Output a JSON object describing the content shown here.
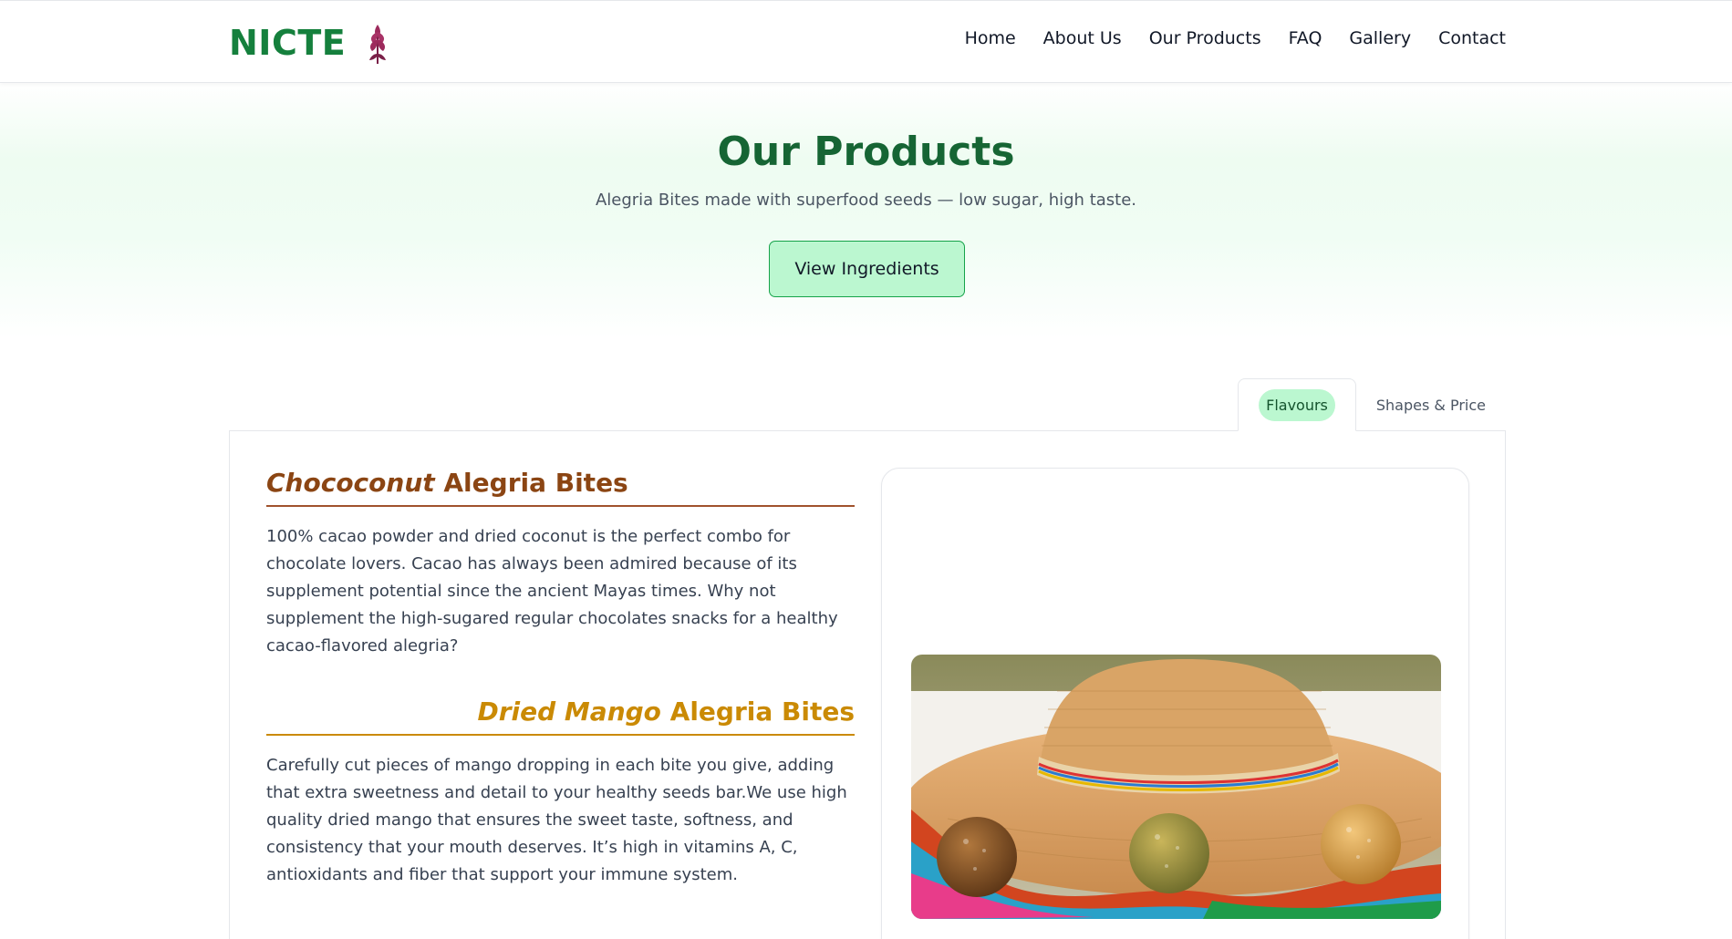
{
  "brand": {
    "name": "NICTE",
    "logo_icon": "amaranth-plant-icon"
  },
  "nav": {
    "items": [
      {
        "label": "Home"
      },
      {
        "label": "About Us"
      },
      {
        "label": "Our Products"
      },
      {
        "label": "FAQ"
      },
      {
        "label": "Gallery"
      },
      {
        "label": "Contact"
      }
    ]
  },
  "hero": {
    "title": "Our Products",
    "subtitle": "Alegria Bites made with superfood seeds — low sugar, high taste.",
    "cta_label": "View Ingredients"
  },
  "tabs": [
    {
      "label": "Flavours",
      "active": true
    },
    {
      "label": "Shapes & Price",
      "active": false
    }
  ],
  "products": [
    {
      "flavour": "Chococonut",
      "suffix": "Alegria Bites",
      "description": "100% cacao powder and dried coconut is the perfect combo for chocolate lovers. Cacao has always been admired because of its supplement potential since the ancient Mayas times. Why not supplement the high-sugared regular chocolates snacks for a healthy cacao-flavored alegria?",
      "color": "#8b4513"
    },
    {
      "flavour": "Dried Mango",
      "suffix": "Alegria Bites",
      "description": "Carefully cut pieces of mango dropping in each bite you give, adding that extra sweetness and detail to your healthy seeds bar.We use high quality dried mango that ensures the sweet taste, softness, and consistency that your mouth deserves. It’s high in vitamins A, C, antioxidants and fiber that support your immune system.",
      "color": "#ca8a04"
    }
  ],
  "colors": {
    "brand_green": "#15803d",
    "title_green": "#166534",
    "cta_bg": "#bbf7d0",
    "cta_border": "#16a34a"
  }
}
